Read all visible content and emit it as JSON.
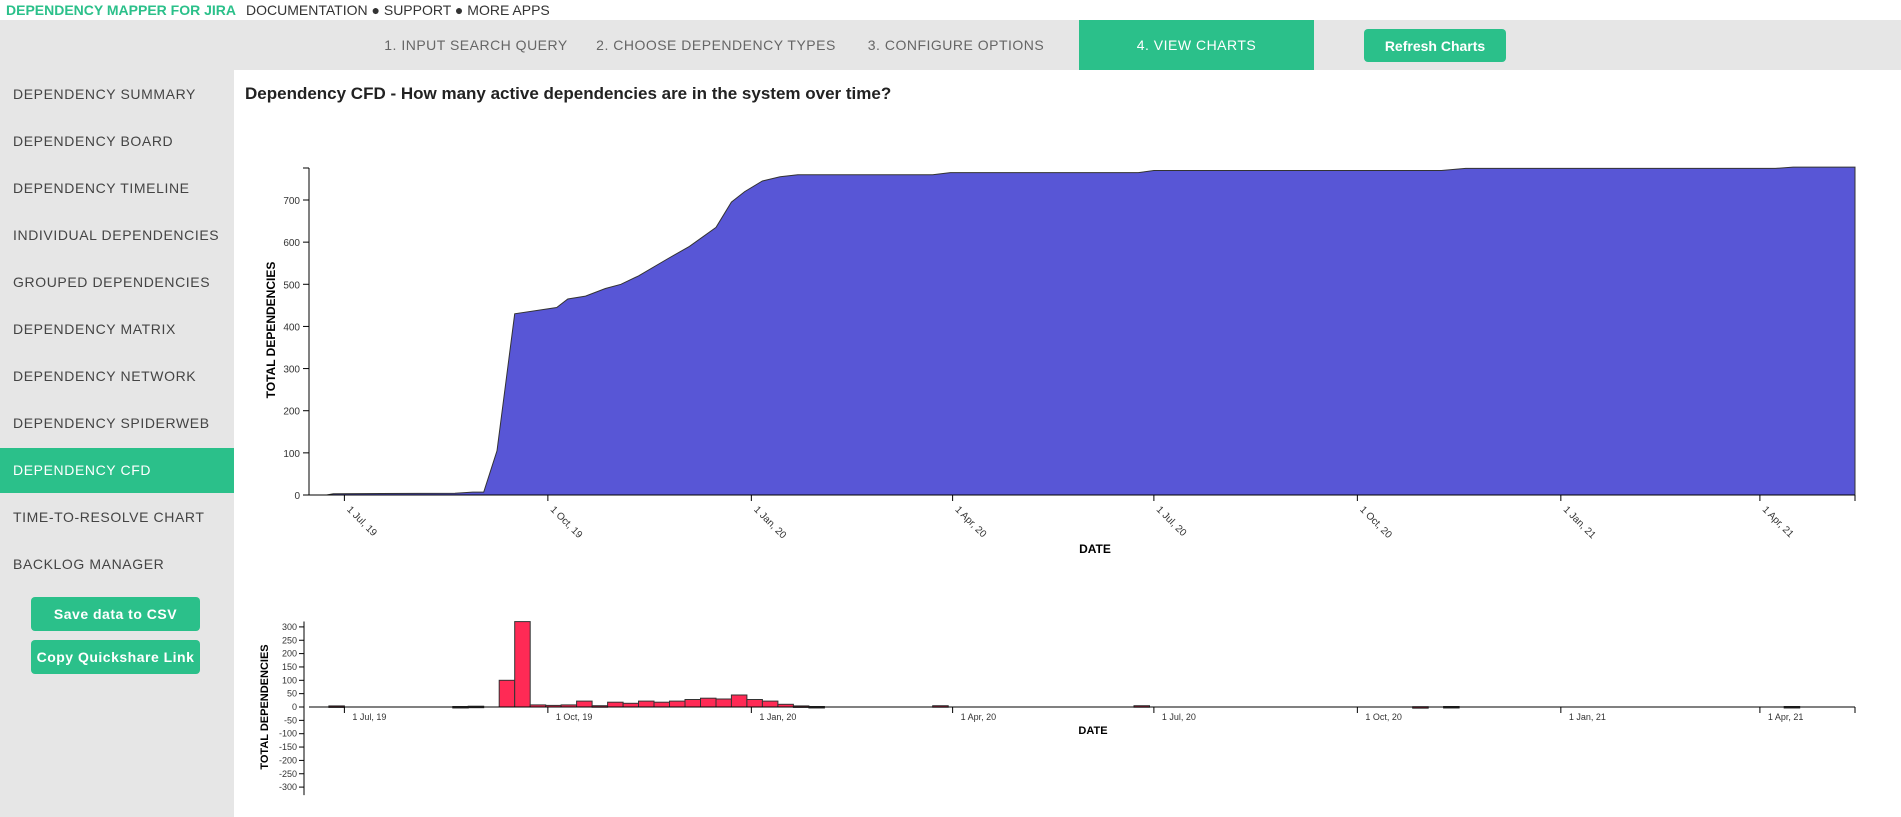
{
  "header": {
    "brand": "DEPENDENCY MAPPER FOR JIRA",
    "links": [
      "DOCUMENTATION",
      "SUPPORT",
      "MORE APPS"
    ],
    "separator": "●"
  },
  "steps": [
    "1. INPUT SEARCH QUERY",
    "2. CHOOSE DEPENDENCY TYPES",
    "3. CONFIGURE OPTIONS",
    "4. VIEW CHARTS"
  ],
  "active_step": 3,
  "refresh_label": "Refresh Charts",
  "sidebar": {
    "items": [
      "DEPENDENCY SUMMARY",
      "DEPENDENCY BOARD",
      "DEPENDENCY TIMELINE",
      "INDIVIDUAL DEPENDENCIES",
      "GROUPED DEPENDENCIES",
      "DEPENDENCY MATRIX",
      "DEPENDENCY NETWORK",
      "DEPENDENCY SPIDERWEB",
      "DEPENDENCY CFD",
      "TIME-TO-RESOLVE CHART",
      "BACKLOG MANAGER"
    ],
    "active": 8,
    "save_csv": "Save data to CSV",
    "copy_link": "Copy Quickshare Link"
  },
  "colors": {
    "accent": "#2bc08a",
    "area": "#5856d6",
    "bars": "#ff2a55"
  },
  "page_title": "Dependency CFD - How many active dependencies are in the system over time?",
  "chart_data": [
    {
      "type": "area",
      "xlabel": "DATE",
      "ylabel": "TOTAL DEPENDENCIES",
      "xlim": [
        "2019-06-15",
        "2021-05-14"
      ],
      "ylim": [
        0,
        776
      ],
      "yticks": [
        0,
        100,
        200,
        300,
        400,
        500,
        600,
        700
      ],
      "xticks": [
        {
          "date": "2019-07-01",
          "label": "1 Jul, 19"
        },
        {
          "date": "2019-10-01",
          "label": "1 Oct, 19"
        },
        {
          "date": "2020-01-01",
          "label": "1 Jan, 20"
        },
        {
          "date": "2020-04-01",
          "label": "1 Apr, 20"
        },
        {
          "date": "2020-07-01",
          "label": "1 Jul, 20"
        },
        {
          "date": "2020-10-01",
          "label": "1 Oct, 20"
        },
        {
          "date": "2021-01-01",
          "label": "1 Jan, 21"
        },
        {
          "date": "2021-04-01",
          "label": "1 Apr, 21"
        }
      ],
      "points": [
        [
          "2019-06-15",
          0
        ],
        [
          "2019-06-23",
          0
        ],
        [
          "2019-06-26",
          3
        ],
        [
          "2019-08-20",
          4
        ],
        [
          "2019-08-28",
          7
        ],
        [
          "2019-09-02",
          7
        ],
        [
          "2019-09-08",
          105
        ],
        [
          "2019-09-16",
          430
        ],
        [
          "2019-10-05",
          445
        ],
        [
          "2019-10-10",
          465
        ],
        [
          "2019-10-18",
          472
        ],
        [
          "2019-10-27",
          490
        ],
        [
          "2019-11-03",
          500
        ],
        [
          "2019-11-11",
          520
        ],
        [
          "2019-11-24",
          560
        ],
        [
          "2019-12-04",
          590
        ],
        [
          "2019-12-16",
          635
        ],
        [
          "2019-12-23",
          695
        ],
        [
          "2019-12-29",
          720
        ],
        [
          "2020-01-06",
          745
        ],
        [
          "2020-01-14",
          755
        ],
        [
          "2020-01-22",
          760
        ],
        [
          "2020-03-23",
          760
        ],
        [
          "2020-03-31",
          765
        ],
        [
          "2020-06-24",
          765
        ],
        [
          "2020-07-01",
          770
        ],
        [
          "2020-11-08",
          770
        ],
        [
          "2020-11-19",
          775
        ],
        [
          "2021-04-08",
          775
        ],
        [
          "2021-04-16",
          778
        ],
        [
          "2021-05-14",
          778
        ]
      ]
    },
    {
      "type": "bar",
      "xlabel": "DATE",
      "ylabel": "TOTAL DEPENDENCIES",
      "ylim": [
        -320,
        320
      ],
      "yticks": [
        300,
        250,
        200,
        150,
        100,
        50,
        0,
        -50,
        -100,
        -150,
        -200,
        -250,
        -300
      ],
      "xticks": [
        {
          "date": "2019-07-01",
          "label": "1 Jul, 19"
        },
        {
          "date": "2019-10-01",
          "label": "1 Oct, 19"
        },
        {
          "date": "2020-01-01",
          "label": "1 Jan, 20"
        },
        {
          "date": "2020-04-01",
          "label": "1 Apr, 20"
        },
        {
          "date": "2020-07-01",
          "label": "1 Jul, 20"
        },
        {
          "date": "2020-10-01",
          "label": "1 Oct, 20"
        },
        {
          "date": "2021-01-01",
          "label": "1 Jan, 21"
        },
        {
          "date": "2021-04-01",
          "label": "1 Apr, 21"
        }
      ],
      "bars": [
        [
          "2019-06-24",
          4
        ],
        [
          "2019-08-19",
          2
        ],
        [
          "2019-08-26",
          3
        ],
        [
          "2019-09-09",
          100
        ],
        [
          "2019-09-16",
          320
        ],
        [
          "2019-09-23",
          8
        ],
        [
          "2019-09-30",
          6
        ],
        [
          "2019-10-07",
          8
        ],
        [
          "2019-10-14",
          22
        ],
        [
          "2019-10-21",
          5
        ],
        [
          "2019-10-28",
          18
        ],
        [
          "2019-11-04",
          14
        ],
        [
          "2019-11-11",
          22
        ],
        [
          "2019-11-18",
          18
        ],
        [
          "2019-11-25",
          22
        ],
        [
          "2019-12-02",
          28
        ],
        [
          "2019-12-09",
          33
        ],
        [
          "2019-12-16",
          30
        ],
        [
          "2019-12-23",
          45
        ],
        [
          "2019-12-30",
          28
        ],
        [
          "2020-01-06",
          22
        ],
        [
          "2020-01-13",
          10
        ],
        [
          "2020-01-20",
          4
        ],
        [
          "2020-01-27",
          2
        ],
        [
          "2020-03-23",
          5
        ],
        [
          "2020-06-22",
          5
        ],
        [
          "2020-10-26",
          1
        ],
        [
          "2020-11-09",
          2
        ],
        [
          "2021-04-12",
          2
        ]
      ]
    }
  ]
}
